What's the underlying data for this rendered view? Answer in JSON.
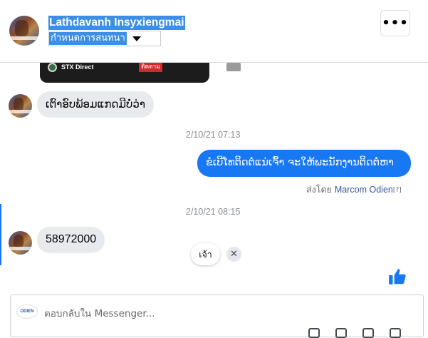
{
  "header": {
    "name": "Lathdavanh Insyxiengmai",
    "assign_select": "กำหนดการสนทนา",
    "more_label": "•••"
  },
  "media_card": {
    "channel": "STX Direct",
    "subscribe": "ติดตาม"
  },
  "messages": [
    {
      "dir": "in",
      "text": "ເຕົາອົບພ້ອມແກດມີບໍ່ວ່າ"
    },
    {
      "dir": "ts",
      "text": "2/10/21 07:13"
    },
    {
      "dir": "out",
      "text": "ຂໍເບີໂທຕິດຕໍ່ແນ່ເຈົ້າ ຈະໃຫ້ພະນັກງານຕິດຕໍ່ຫາ"
    },
    {
      "dir": "sent_by",
      "prefix": "ส่งโดย",
      "who": "Marcom Odien",
      "help": "[?]"
    },
    {
      "dir": "ts",
      "text": "2/10/21 08:15"
    },
    {
      "dir": "in",
      "text": "58972000"
    }
  ],
  "quick_reply": {
    "label": "เจ้า",
    "close": "✕"
  },
  "composer": {
    "page_logo": "ODIEN",
    "placeholder": "ตอบกลับใน Messenger..."
  },
  "icons": {
    "more": "ellipsis-icon",
    "like": "thumbs-up-icon",
    "close": "close-icon",
    "caret": "caret-down-icon"
  },
  "colors": {
    "accent": "#1877f2",
    "highlight": "#3d8ee6",
    "bubble_in": "#e9eaed"
  }
}
